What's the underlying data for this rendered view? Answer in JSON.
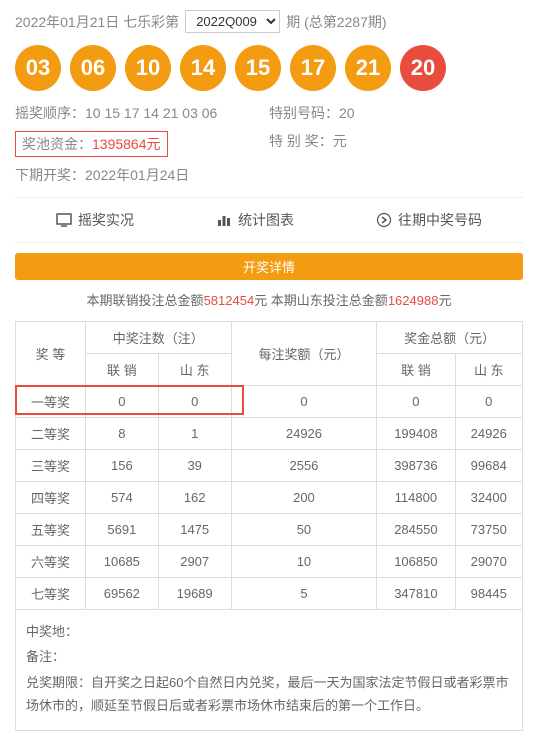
{
  "header": {
    "date_text": "2022年01月21日 七乐彩第",
    "period_select": "2022Q009",
    "period_suffix": "期 (总第2287期)"
  },
  "balls": [
    "03",
    "06",
    "10",
    "14",
    "15",
    "17",
    "21",
    "20"
  ],
  "info": {
    "draw_order_label": "摇奖顺序：",
    "draw_order": "10 15 17 14 21 03 06",
    "special_num_label": "特别号码：",
    "special_num": "20",
    "pool_label": "奖池资金：",
    "pool_amount": "1395864",
    "pool_unit": "元",
    "special_prize_label": "特 别 奖：",
    "special_prize_unit": "元",
    "next_draw_label": "下期开奖：",
    "next_draw": "2022年01月24日"
  },
  "tabs": {
    "live": "摇奖实况",
    "stats": "统计图表",
    "history": "往期中奖号码"
  },
  "details_btn": "开奖详情",
  "summary": {
    "prefix1": "本期联销投注总金额",
    "amt1": "5812454",
    "mid": "元 本期山东投注总金额",
    "amt2": "1624988",
    "suffix": "元"
  },
  "table": {
    "h_count": "中奖注数（注）",
    "h_per": "每注奖额（元）",
    "h_total": "奖金总额（元）",
    "h_level": "奖 等",
    "h_lx": "联 销",
    "h_sd": "山 东",
    "rows": [
      {
        "level": "一等奖",
        "lx": "0",
        "sd": "0",
        "per": "0",
        "tlx": "0",
        "tsd": "0"
      },
      {
        "level": "二等奖",
        "lx": "8",
        "sd": "1",
        "per": "24926",
        "tlx": "199408",
        "tsd": "24926"
      },
      {
        "level": "三等奖",
        "lx": "156",
        "sd": "39",
        "per": "2556",
        "tlx": "398736",
        "tsd": "99684"
      },
      {
        "level": "四等奖",
        "lx": "574",
        "sd": "162",
        "per": "200",
        "tlx": "114800",
        "tsd": "32400"
      },
      {
        "level": "五等奖",
        "lx": "5691",
        "sd": "1475",
        "per": "50",
        "tlx": "284550",
        "tsd": "73750"
      },
      {
        "level": "六等奖",
        "lx": "10685",
        "sd": "2907",
        "per": "10",
        "tlx": "106850",
        "tsd": "29070"
      },
      {
        "level": "七等奖",
        "lx": "69562",
        "sd": "19689",
        "per": "5",
        "tlx": "347810",
        "tsd": "98445"
      }
    ]
  },
  "notes": {
    "loc_label": "中奖地：",
    "remark_label": "备注：",
    "claim_label": "兑奖期限：",
    "claim_text": "自开奖之日起60个自然日内兑奖，最后一天为国家法定节假日或者彩票市场休市的，顺延至节假日后或者彩票市场休市结束后的第一个工作日。"
  }
}
